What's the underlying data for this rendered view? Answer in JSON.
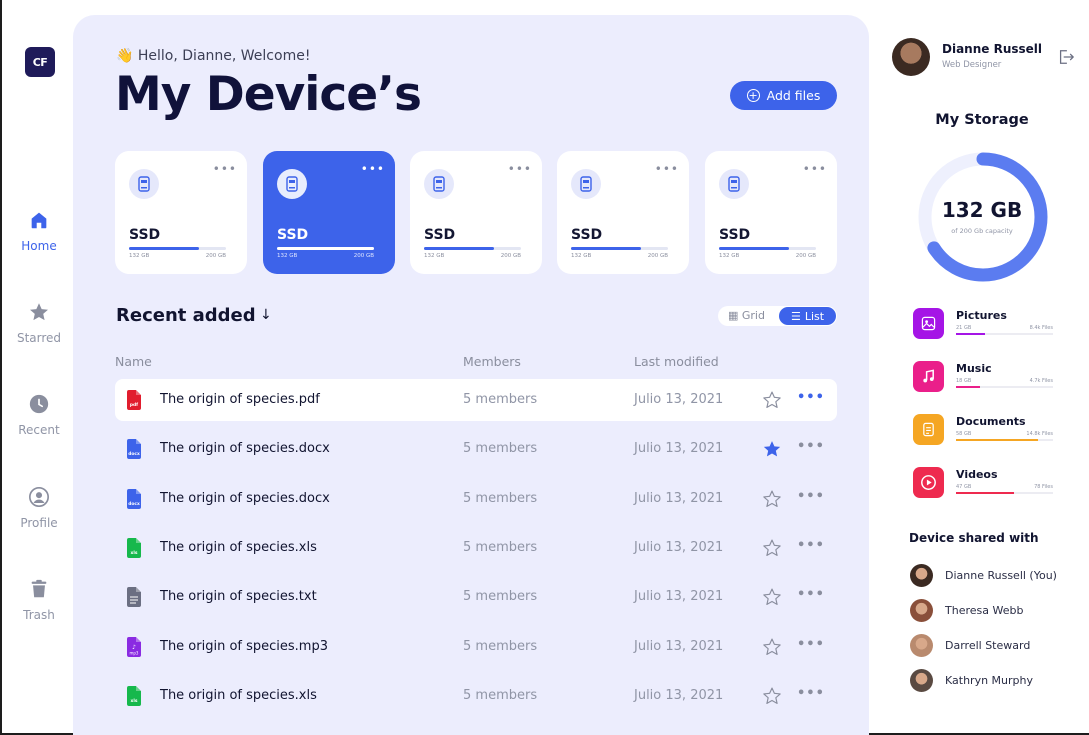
{
  "app": {
    "logo_text": "CF"
  },
  "nav": [
    {
      "label": "Home",
      "icon": "home-icon",
      "active": true
    },
    {
      "label": "Starred",
      "icon": "star-icon",
      "active": false
    },
    {
      "label": "Recent",
      "icon": "clock-icon",
      "active": false
    },
    {
      "label": "Profile",
      "icon": "user-icon",
      "active": false
    },
    {
      "label": "Trash",
      "icon": "trash-icon",
      "active": false
    }
  ],
  "header": {
    "greeting": "👋 Hello, Dianne, Welcome!",
    "title": "My Device’s",
    "add_button": "Add files"
  },
  "devices": [
    {
      "name": "SSD",
      "used": "132 GB",
      "capacity": "200 GB",
      "fill_fraction": 0.72,
      "selected": false
    },
    {
      "name": "SSD",
      "used": "132 GB",
      "capacity": "200 GB",
      "fill_fraction": 1.0,
      "selected": true
    },
    {
      "name": "SSD",
      "used": "132 GB",
      "capacity": "200 GB",
      "fill_fraction": 0.72,
      "selected": false
    },
    {
      "name": "SSD",
      "used": "132 GB",
      "capacity": "200 GB",
      "fill_fraction": 0.72,
      "selected": false
    },
    {
      "name": "SSD",
      "used": "132 GB",
      "capacity": "200 GB",
      "fill_fraction": 0.72,
      "selected": false
    }
  ],
  "recent": {
    "title": "Recent added",
    "view_grid": "Grid",
    "view_list": "List",
    "columns": {
      "name": "Name",
      "members": "Members",
      "modified": "Last modified"
    },
    "files": [
      {
        "name": "The origin of species.pdf",
        "type": "pdf",
        "members": "5 members",
        "date": "Julio 13, 2021",
        "starred": false,
        "highlighted": true
      },
      {
        "name": "The origin of species.docx",
        "type": "docx",
        "members": "5 members",
        "date": "Julio 13, 2021",
        "starred": true,
        "highlighted": false
      },
      {
        "name": "The origin of species.docx",
        "type": "docx",
        "members": "5 members",
        "date": "Julio 13, 2021",
        "starred": false,
        "highlighted": false
      },
      {
        "name": "The origin of species.xls",
        "type": "xls",
        "members": "5 members",
        "date": "Julio 13, 2021",
        "starred": false,
        "highlighted": false
      },
      {
        "name": "The origin of species.txt",
        "type": "txt",
        "members": "5 members",
        "date": "Julio 13, 2021",
        "starred": false,
        "highlighted": false
      },
      {
        "name": "The origin of species.mp3",
        "type": "mp3",
        "members": "5 members",
        "date": "Julio 13, 2021",
        "starred": false,
        "highlighted": false
      },
      {
        "name": "The origin of species.xls",
        "type": "xls",
        "members": "5 members",
        "date": "Julio 13, 2021",
        "starred": false,
        "highlighted": false
      }
    ]
  },
  "user": {
    "name": "Dianne Russell",
    "role": "Web Designer"
  },
  "storage": {
    "title": "My Storage",
    "used": "132 GB",
    "capacity_text": "of 200 Gb capacity",
    "used_fraction": 0.66,
    "categories": [
      {
        "name": "Pictures",
        "size": "21 GB",
        "files": "8.4k Files",
        "color": "#a515e6",
        "fill_fraction": 0.3,
        "icon": "image-icon"
      },
      {
        "name": "Music",
        "size": "18 GB",
        "files": "4.7k Files",
        "color": "#ea1f8a",
        "fill_fraction": 0.25,
        "icon": "music-icon"
      },
      {
        "name": "Documents",
        "size": "58 GB",
        "files": "14.8k Files",
        "color": "#f5a623",
        "fill_fraction": 0.85,
        "icon": "document-icon"
      },
      {
        "name": "Videos",
        "size": "47 GB",
        "files": "78 Files",
        "color": "#ee2a4f",
        "fill_fraction": 0.6,
        "icon": "video-icon"
      }
    ]
  },
  "shared": {
    "title": "Device shared with",
    "people": [
      {
        "name": "Dianne Russell (You)",
        "color": "#3b2a22"
      },
      {
        "name": "Theresa Webb",
        "color": "#8a4f3a"
      },
      {
        "name": "Darrell Steward",
        "color": "#b98a6e"
      },
      {
        "name": "Kathryn Murphy",
        "color": "#5a4a42"
      }
    ]
  },
  "colors": {
    "accent": "#3d63ea",
    "panel": "#ecedfd",
    "text": "#111430",
    "muted": "#9095a6"
  }
}
